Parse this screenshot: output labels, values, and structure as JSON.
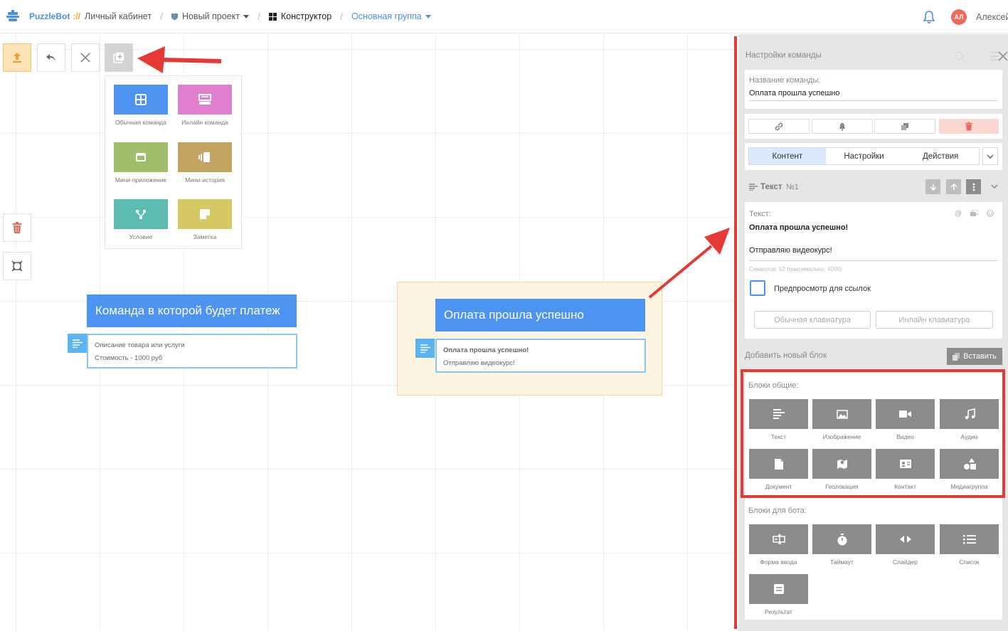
{
  "header": {
    "logo": "PuzzleBot",
    "logo_slash": "://",
    "crumbs": [
      "Личный кабинет",
      "Новый проект",
      "Конструктор",
      "Основная группа"
    ],
    "avatar_initials": "АЛ",
    "user_name": "Алексей"
  },
  "add_menu": {
    "items": [
      {
        "label": "Обычная команда",
        "color": "#4d93f0",
        "icon": "grid-icon"
      },
      {
        "label": "Инлайн команда",
        "color": "#e07ed0",
        "icon": "inline-menu-icon"
      },
      {
        "label": "Мини-приложение",
        "color": "#9fbd6b",
        "icon": "window-icon"
      },
      {
        "label": "Мини-история",
        "color": "#c4a361",
        "icon": "stories-icon"
      },
      {
        "label": "Условие",
        "color": "#5dbcb0",
        "icon": "branch-icon"
      },
      {
        "label": "Заметка",
        "color": "#d6c863",
        "icon": "note-icon"
      }
    ]
  },
  "nodes": [
    {
      "title": "Команда в которой будет платеж",
      "lines": [
        "Описание товара или услуги",
        "Стоимость  - 1000 руб"
      ]
    },
    {
      "title": "Оплата прошла успешно",
      "lines": [
        "Оплата прошла успешно!",
        "Отправляю видеокурс!"
      ]
    }
  ],
  "panel": {
    "title": "Настройки команды",
    "name_label": "Название команды:",
    "name_value": "Оплата прошла успешно",
    "tabs": [
      "Контент",
      "Настройки",
      "Действия"
    ],
    "active_tab": "Контент",
    "text_block": {
      "title": "Текст",
      "number": "№1",
      "label": "Текст:",
      "line1": "Оплата прошла успешно!",
      "line2": "Отправляю видеокурс!",
      "counter": "Символов: 52 (максимально: 4096)",
      "preview_label": "Предпросмотр для ссылок",
      "btn_regular_kb": "Обычная клавиатура",
      "btn_inline_kb": "Инлайн клавиатура"
    },
    "add_block_label": "Добавить новый блок",
    "paste_label": "Вставить",
    "general_title": "Блоки общие:",
    "general_blocks": [
      {
        "label": "Текст",
        "icon": "text-icon"
      },
      {
        "label": "Изображение",
        "icon": "image-icon"
      },
      {
        "label": "Видео",
        "icon": "video-icon"
      },
      {
        "label": "Аудио",
        "icon": "music-icon"
      },
      {
        "label": "Документ",
        "icon": "document-icon"
      },
      {
        "label": "Геолокация",
        "icon": "map-icon"
      },
      {
        "label": "Контакт",
        "icon": "contact-icon"
      },
      {
        "label": "Медиагруппа",
        "icon": "media-group-icon"
      }
    ],
    "bot_title": "Блоки для бота:",
    "bot_blocks": [
      {
        "label": "Форма ввода",
        "icon": "input-form-icon"
      },
      {
        "label": "Таймаут",
        "icon": "stopwatch-icon"
      },
      {
        "label": "Слайдер",
        "icon": "slider-icon"
      },
      {
        "label": "Список",
        "icon": "list-icon"
      },
      {
        "label": "Результат",
        "icon": "result-icon"
      }
    ]
  },
  "colors": {
    "accent": "#4d93f0",
    "annotation_red": "#e53935",
    "danger": "#ef6a5b"
  }
}
